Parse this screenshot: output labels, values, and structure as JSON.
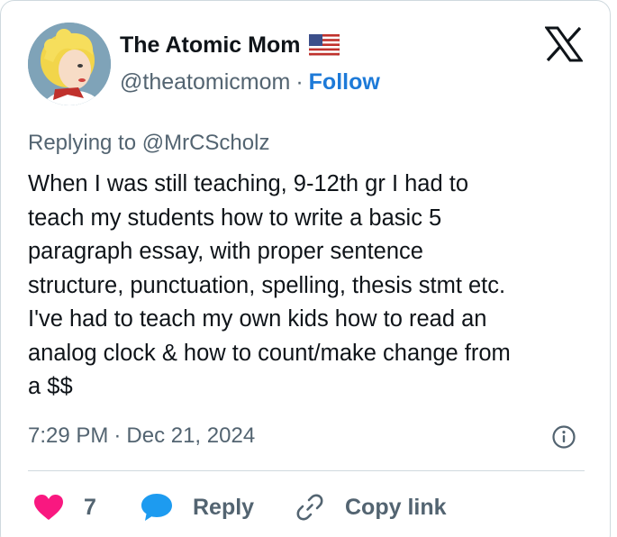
{
  "author": {
    "display_name": "The Atomic Mom",
    "handle": "@theatomicmom",
    "separator": "·",
    "follow_label": "Follow",
    "avatar_icon": "avatar-icon",
    "flag_icon": "us-flag-icon"
  },
  "reply_context": "Replying to @MrCScholz",
  "tweet": {
    "text": "When I was still teaching, 9-12th gr I had to\nteach my students how to write a basic 5\nparagraph essay, with proper sentence\nstructure, punctuation, spelling, thesis stmt etc.\nI've had to teach my own kids how to read an\nanalog clock & how to count/make change from\na $$"
  },
  "meta": {
    "time": "7:29 PM",
    "separator": "·",
    "date": "Dec 21, 2024"
  },
  "actions": {
    "like_count": "7",
    "reply_label": "Reply",
    "copy_link_label": "Copy link"
  },
  "colors": {
    "like": "#f91880",
    "reply": "#1d9bf0",
    "link": "#1d7ad8",
    "muted": "#536471",
    "text": "#0f1419",
    "border": "#cfd9de"
  },
  "icons": {
    "platform": "x-logo-icon",
    "info": "info-icon",
    "like": "heart-icon",
    "reply": "speech-bubble-icon",
    "copy_link": "link-icon"
  }
}
